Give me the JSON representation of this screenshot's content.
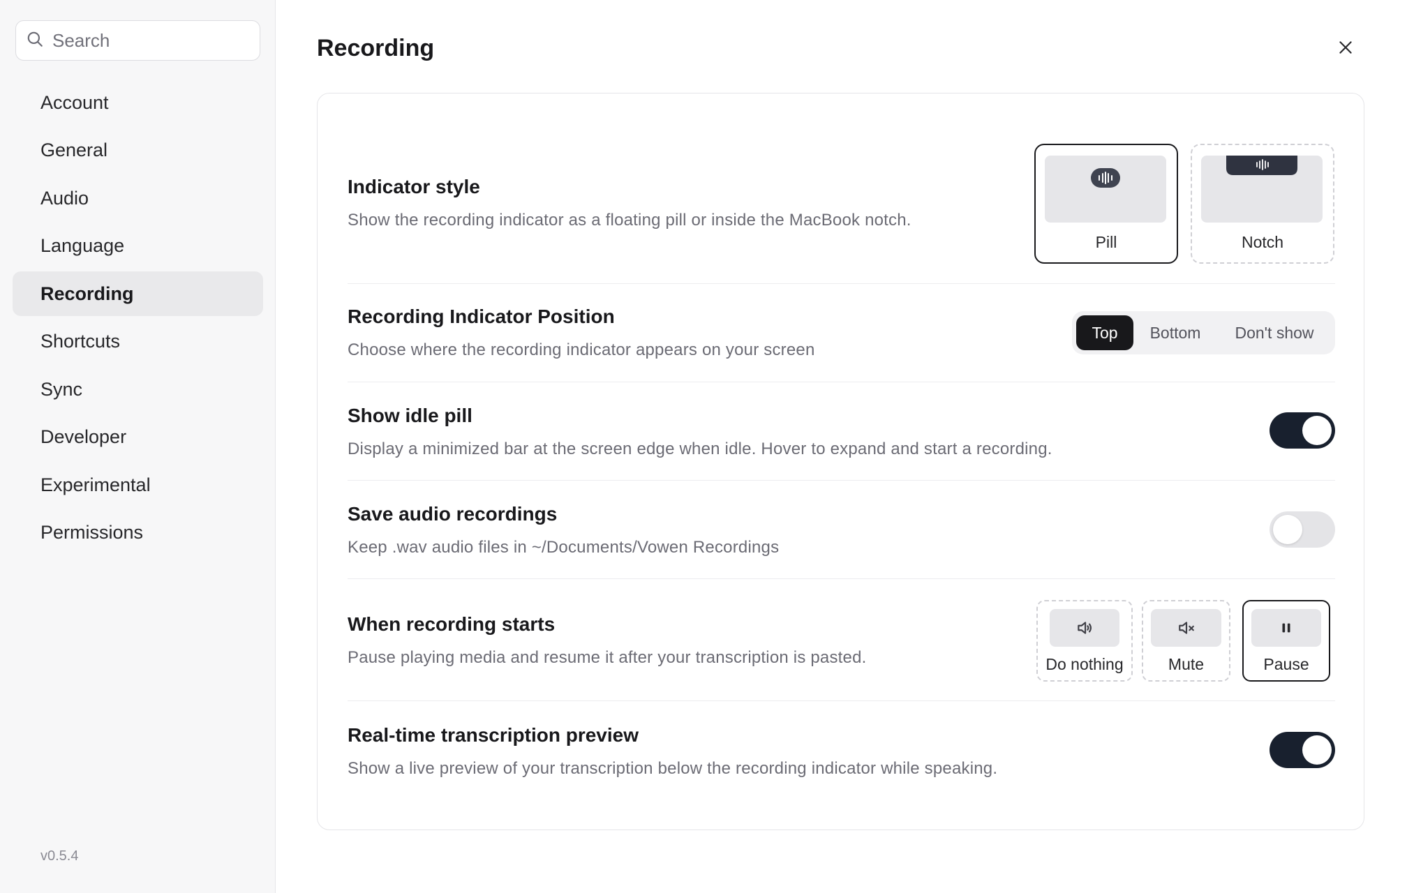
{
  "sidebar": {
    "search_placeholder": "Search",
    "items": [
      {
        "label": "Account"
      },
      {
        "label": "General"
      },
      {
        "label": "Audio"
      },
      {
        "label": "Language"
      },
      {
        "label": "Recording",
        "active": true
      },
      {
        "label": "Shortcuts"
      },
      {
        "label": "Sync"
      },
      {
        "label": "Developer"
      },
      {
        "label": "Experimental"
      },
      {
        "label": "Permissions"
      }
    ],
    "version": "v0.5.4"
  },
  "page": {
    "title": "Recording"
  },
  "settings": {
    "indicator_style": {
      "title": "Indicator style",
      "description": "Show the recording indicator as a floating pill or inside the MacBook notch.",
      "options": [
        {
          "label": "Pill",
          "selected": true
        },
        {
          "label": "Notch",
          "selected": false
        }
      ]
    },
    "indicator_position": {
      "title": "Recording Indicator Position",
      "description": "Choose where the recording indicator appears on your screen",
      "options": [
        {
          "label": "Top",
          "selected": true
        },
        {
          "label": "Bottom",
          "selected": false
        },
        {
          "label": "Don't show",
          "selected": false
        }
      ]
    },
    "idle_pill": {
      "title": "Show idle pill",
      "description": "Display a minimized bar at the screen edge when idle. Hover to expand and start a recording.",
      "enabled": true
    },
    "save_audio": {
      "title": "Save audio recordings",
      "description": "Keep .wav audio files in ~/Documents/Vowen Recordings",
      "enabled": false
    },
    "recording_starts": {
      "title": "When recording starts",
      "description": "Pause playing media and resume it after your transcription is pasted.",
      "options": [
        {
          "label": "Do nothing",
          "icon": "speaker-icon",
          "selected": false
        },
        {
          "label": "Mute",
          "icon": "speaker-mute-icon",
          "selected": false
        },
        {
          "label": "Pause",
          "icon": "pause-icon",
          "selected": true
        }
      ]
    },
    "realtime_preview": {
      "title": "Real-time transcription preview",
      "description": "Show a live preview of your transcription below the recording indicator while speaking.",
      "enabled": true
    }
  },
  "colors": {
    "accent": "#18181b",
    "toggle_on": "#18202e",
    "sidebar_bg": "#f7f7f8"
  }
}
